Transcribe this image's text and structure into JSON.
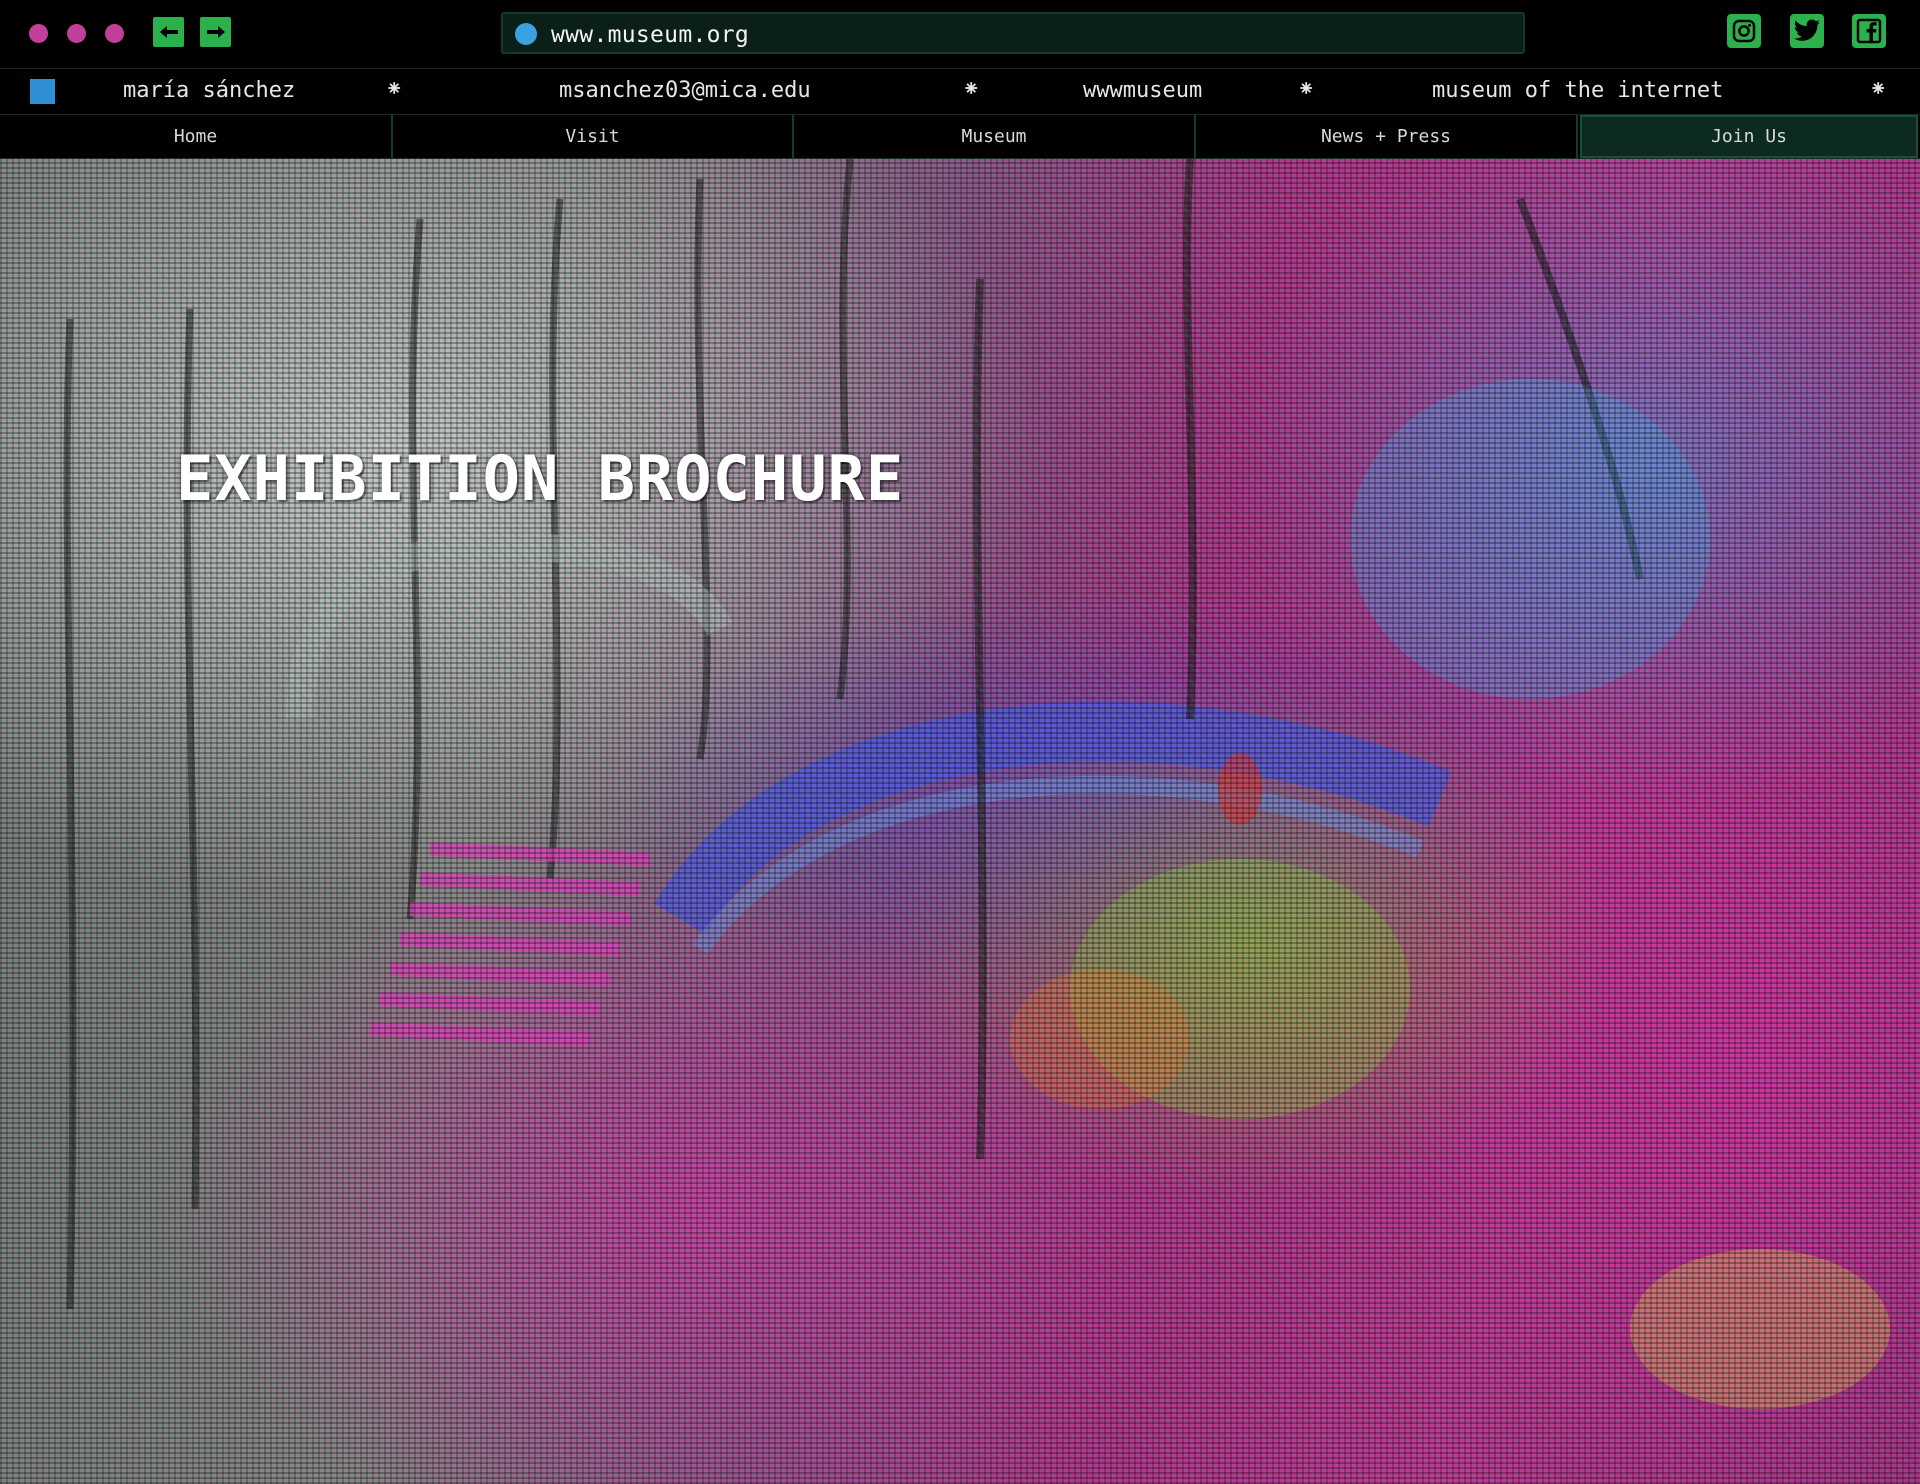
{
  "window": {
    "traffic_lights": [
      {
        "name": "close",
        "color": "#c2409c"
      },
      {
        "name": "minimize",
        "color": "#c2409c"
      },
      {
        "name": "maximize",
        "color": "#c2409c"
      }
    ],
    "back_icon": "back-arrow-icon",
    "forward_icon": "forward-arrow-icon",
    "accent_color": "#2bb24c"
  },
  "addressbar": {
    "url": "www.museum.org",
    "status_dot_color": "#3aa2e0"
  },
  "social": [
    {
      "name": "instagram-icon"
    },
    {
      "name": "twitter-icon"
    },
    {
      "name": "facebook-icon"
    }
  ],
  "infobar": {
    "square_color": "#2f8fd3",
    "name": "maría sánchez",
    "email": "msanchez03@mica.edu",
    "handle": "wwwmuseum",
    "site_title": "museum of the internet",
    "separator": "⁕"
  },
  "menu": {
    "items": [
      {
        "label": "Home"
      },
      {
        "label": "Visit"
      },
      {
        "label": "Museum"
      },
      {
        "label": "News + Press"
      },
      {
        "label": "Join Us"
      }
    ],
    "active": "Join Us"
  },
  "hero": {
    "title": "EXHIBITION BROCHURE"
  }
}
